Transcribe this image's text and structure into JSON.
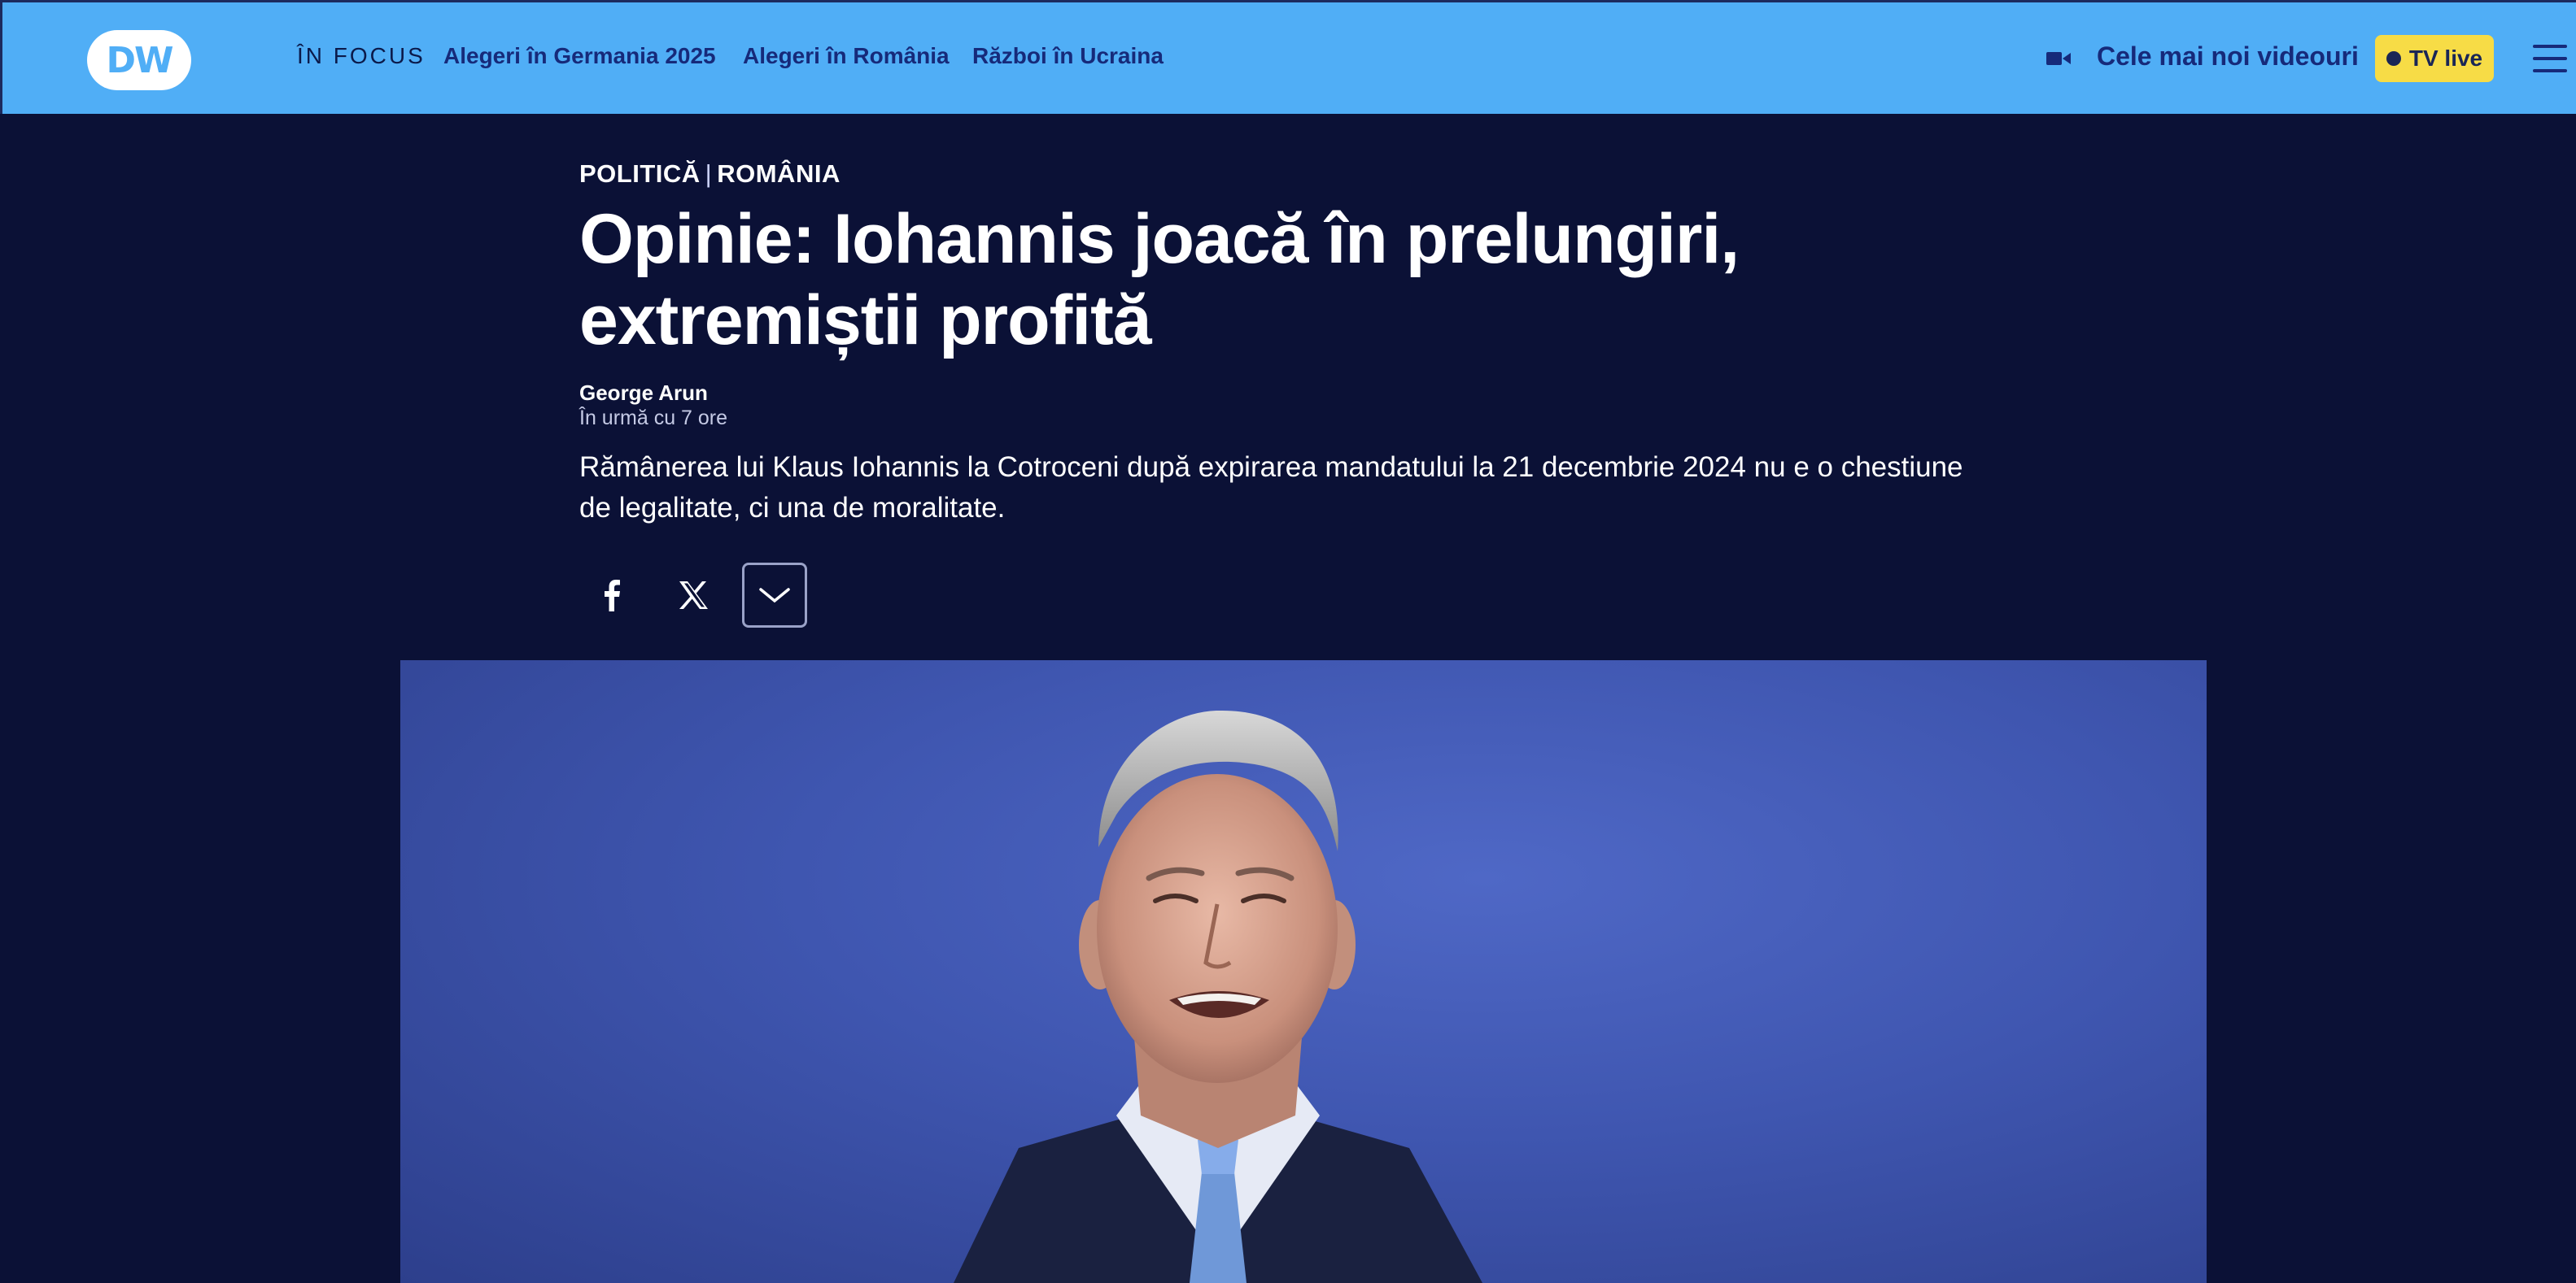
{
  "header": {
    "logo": "DW",
    "in_focus_label": "ÎN FOCUS",
    "topics": [
      "Alegeri în Germania 2025",
      "Alegeri în România",
      "Război în Ucraina"
    ],
    "latest_videos": "Cele mai noi videouri",
    "tv_live": "TV live",
    "icons": [
      "video-camera-icon",
      "hamburger-menu-icon"
    ],
    "colors": {
      "header_bg": "#50aef6",
      "tv_live_bg": "#f7dc46",
      "page_bg": "#0b1136"
    }
  },
  "article": {
    "category": "POLITICĂ",
    "category_separator": "|",
    "region": "ROMÂNIA",
    "title": "Opinie: Iohannis joacă în prelungiri, extremiștii profită",
    "author": "George Arun",
    "time": "În urmă cu 7 ore",
    "lead": "Rămânerea lui Klaus Iohannis la Cotroceni după expirarea mandatului la 21 decembrie 2024 nu e o chestiune de legalitate, ci una de moralitate.",
    "share_icons": [
      "facebook-icon",
      "x-icon",
      "chevron-down-icon"
    ]
  }
}
